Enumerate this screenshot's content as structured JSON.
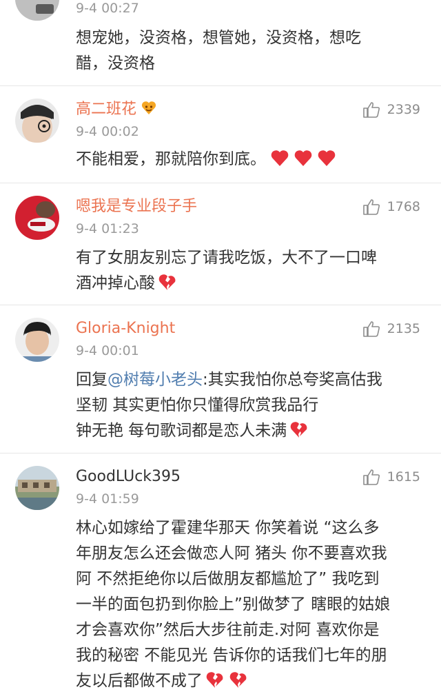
{
  "comments": [
    {
      "username": "",
      "timestamp": "9-4 00:27",
      "likes": "",
      "lines": [
        "想宠她，没资格，想管她，没资格，想吃",
        "醋，没资格"
      ]
    },
    {
      "username": "高二班花",
      "timestamp": "9-4 00:02",
      "likes": "2339",
      "lines": [
        "不能相爱，那就陪你到底。"
      ]
    },
    {
      "username": "嗯我是专业段子手",
      "timestamp": "9-4 01:23",
      "likes": "1768",
      "lines": [
        "有了女朋友别忘了请我吃饭，大不了一口啤",
        "酒冲掉心酸"
      ]
    },
    {
      "username": "Gloria-Knight",
      "timestamp": "9-4 00:01",
      "likes": "2135",
      "reply_prefix": "回复",
      "mention": "@树莓小老头",
      "lines": [
        ":其实我怕你总夸奖高估我",
        "坚韧 其实更怕你只懂得欣赏我品行",
        "钟无艳 每句歌词都是恋人未满"
      ]
    },
    {
      "username": "GoodLUck395",
      "timestamp": "9-4 01:59",
      "likes": "1615",
      "lines": [
        "林心如嫁给了霍建华那天 你笑着说 “这么多",
        "年朋友怎么还会做恋人阿 猪头 你不要喜欢我",
        "阿 不然拒绝你以后做朋友都尴尬了” 我吃到",
        "一半的面包扔到你脸上”别做梦了 瞎眼的姑娘",
        "才会喜欢你”然后大步往前走.对阿 喜欢你是",
        "我的秘密 不能见光 告诉你的话我们七年的朋",
        "友以后都做不成了"
      ]
    }
  ],
  "colors": {
    "username_orange": "#eb7350",
    "mention_blue": "#507daf",
    "heart_red": "#e8323c",
    "timestamp_gray": "#9a9a9a"
  },
  "icons": [
    "thumbs-up-icon",
    "red-heart-icon",
    "broken-heart-icon",
    "member-badge-icon"
  ]
}
